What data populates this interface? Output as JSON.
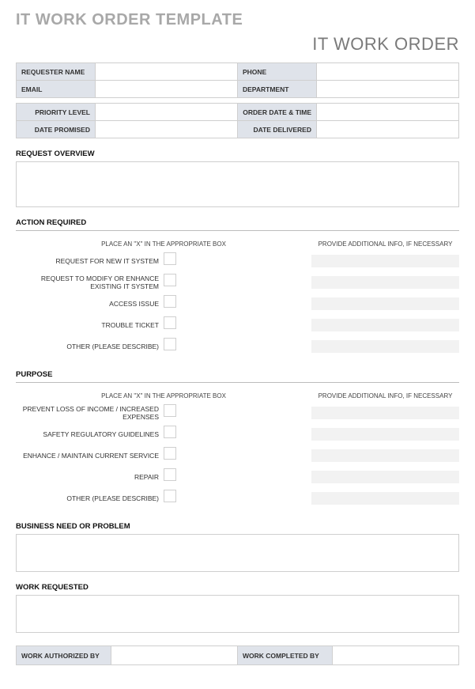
{
  "page_title": "IT WORK ORDER TEMPLATE",
  "sub_title": "IT WORK ORDER",
  "header_row1": {
    "requester_label": "REQUESTER NAME",
    "requester_value": "",
    "phone_label": "PHONE",
    "phone_value": ""
  },
  "header_row2": {
    "email_label": "EMAIL",
    "email_value": "",
    "department_label": "DEPARTMENT",
    "department_value": ""
  },
  "meta_row1": {
    "priority_label": "PRIORITY LEVEL",
    "priority_value": "",
    "order_date_label": "ORDER DATE & TIME",
    "order_date_value": ""
  },
  "meta_row2": {
    "promised_label": "DATE PROMISED",
    "promised_value": "",
    "delivered_label": "DATE DELIVERED",
    "delivered_value": ""
  },
  "sections": {
    "request_overview": "REQUEST OVERVIEW",
    "action_required": "ACTION REQUIRED",
    "purpose": "PURPOSE",
    "business_need": "BUSINESS NEED OR PROBLEM",
    "work_requested": "WORK REQUESTED"
  },
  "hints": {
    "place_x": "PLACE AN \"X\" IN THE APPROPRIATE BOX",
    "additional_info": "PROVIDE ADDITIONAL INFO, IF NECESSARY"
  },
  "action_items": {
    "r1": "REQUEST FOR NEW IT SYSTEM",
    "r2": "REQUEST TO MODIFY OR ENHANCE EXISTING IT SYSTEM",
    "r3": "ACCESS ISSUE",
    "r4": "TROUBLE TICKET",
    "r5": "OTHER (PLEASE DESCRIBE)"
  },
  "purpose_items": {
    "r1": "PREVENT LOSS OF INCOME / INCREASED EXPENSES",
    "r2": "SAFETY REGULATORY GUIDELINES",
    "r3": "ENHANCE / MAINTAIN CURRENT SERVICE",
    "r4": "REPAIR",
    "r5": "OTHER (PLEASE DESCRIBE)"
  },
  "signatures": {
    "authorized_label": "WORK AUTHORIZED BY",
    "authorized_value": "",
    "completed_label": "WORK COMPLETED BY",
    "completed_value": ""
  }
}
